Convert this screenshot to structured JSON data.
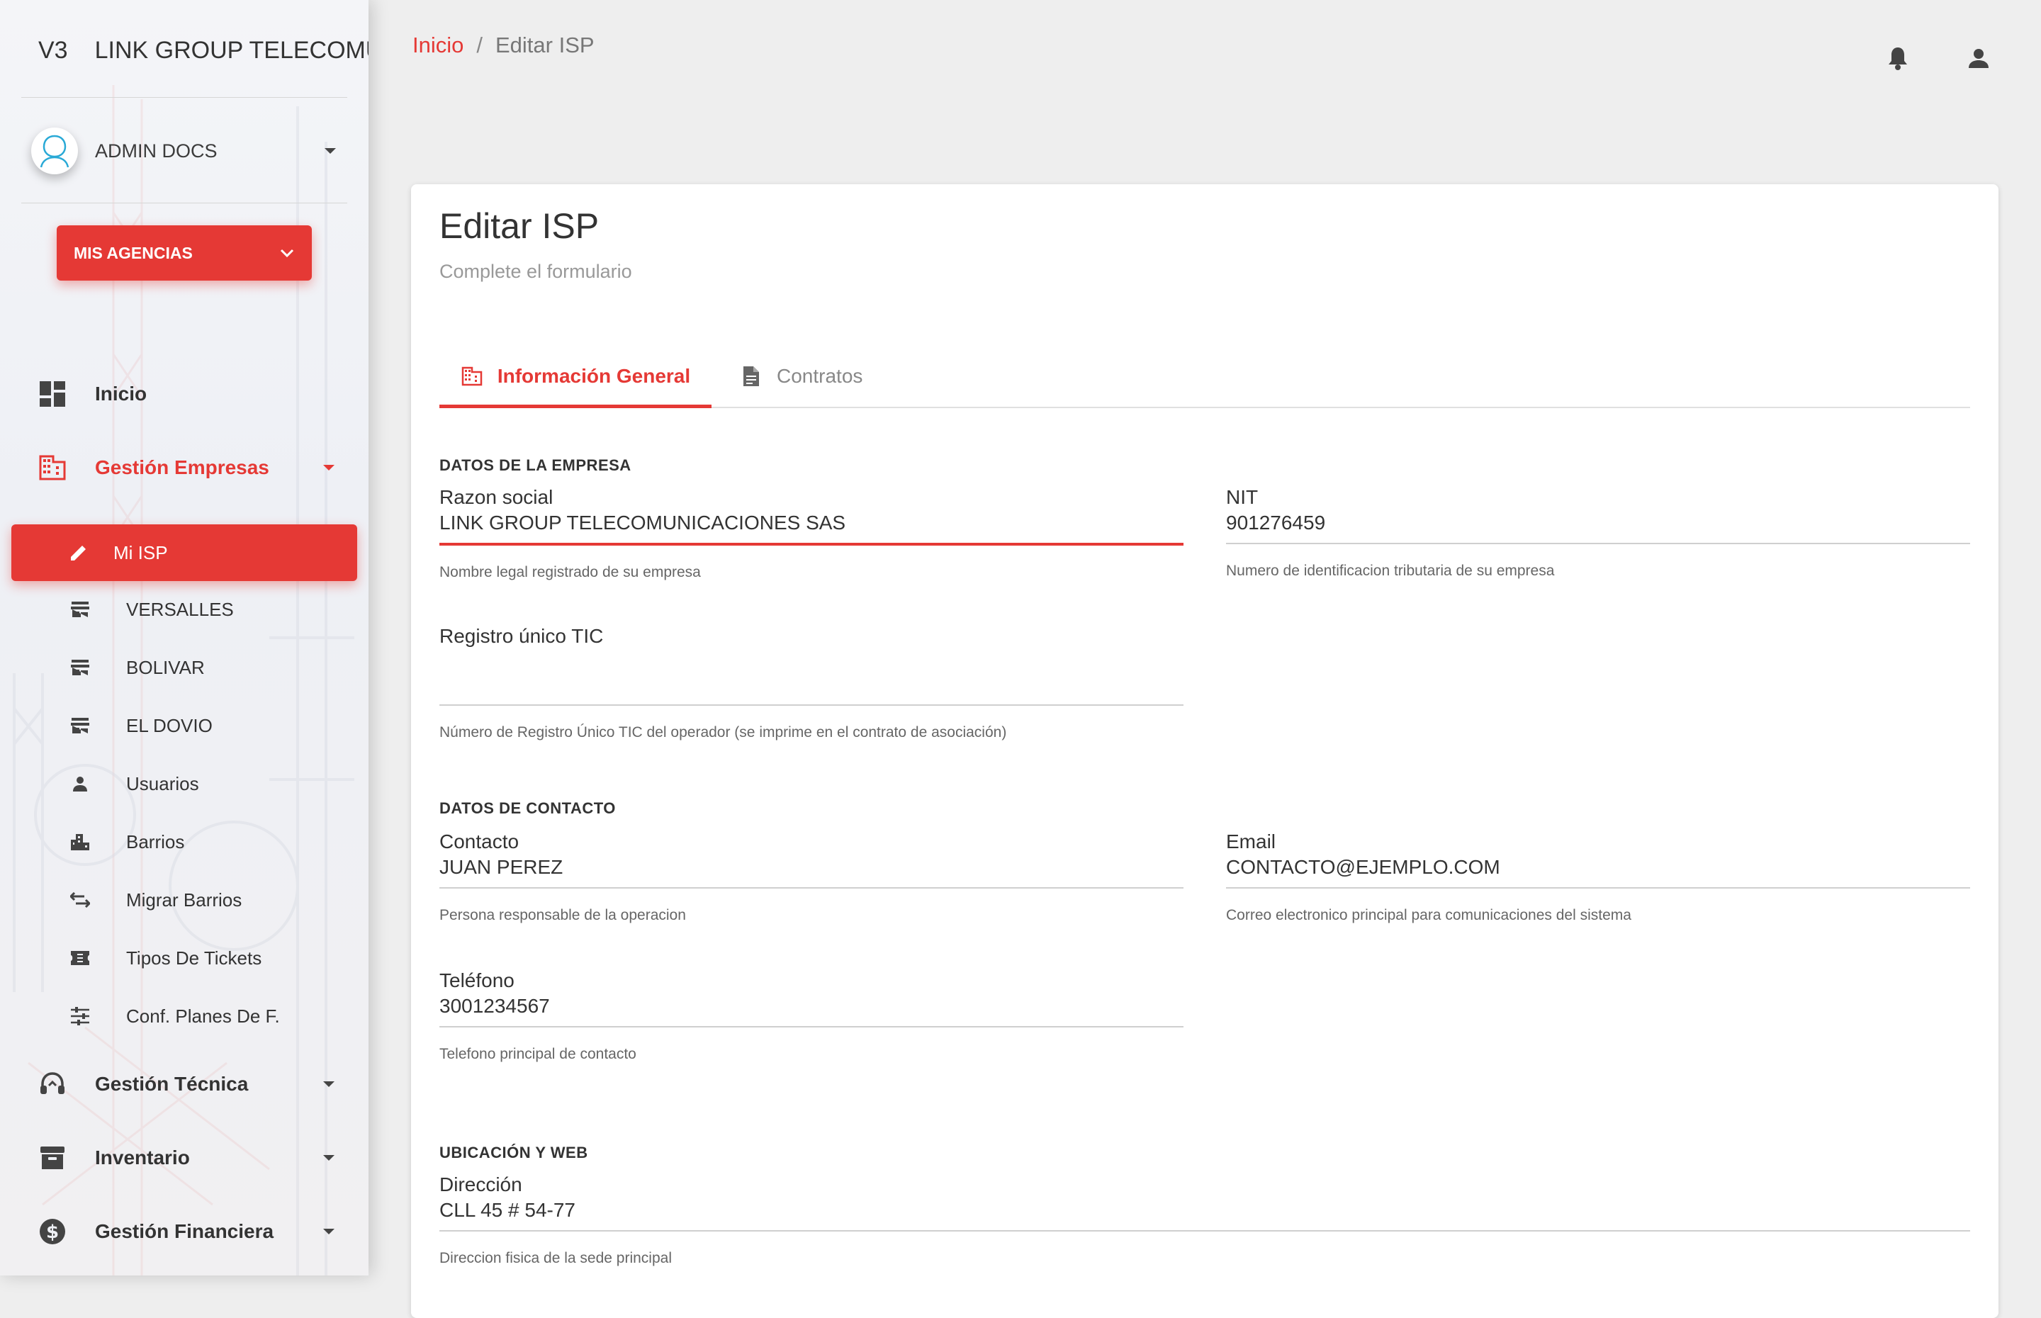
{
  "app": {
    "version": "V3",
    "name": "LINK GROUP TELECOMU"
  },
  "user": {
    "name": "ADMIN DOCS"
  },
  "agency_button": {
    "label": "MIS AGENCIAS"
  },
  "nav": {
    "inicio": "Inicio",
    "gestion_empresas": "Gestión Empresas",
    "gestion_tecnica": "Gestión Técnica",
    "inventario": "Inventario",
    "gestion_financiera": "Gestión Financiera"
  },
  "subnav": {
    "active": "Mi ISP",
    "items": [
      "VERSALLES",
      "BOLIVAR",
      "EL DOVIO",
      "Usuarios",
      "Barrios",
      "Migrar Barrios",
      "Tipos De Tickets",
      "Conf. Planes De F."
    ]
  },
  "breadcrumb": {
    "home": "Inicio",
    "separator": "/",
    "current": "Editar ISP"
  },
  "card": {
    "title": "Editar ISP",
    "subtitle": "Complete el formulario"
  },
  "tabs": [
    "Información General",
    "Contratos"
  ],
  "sections": {
    "empresa": "DATOS DE LA EMPRESA",
    "contacto": "DATOS DE CONTACTO",
    "ubicacion": "UBICACIÓN Y WEB"
  },
  "fields": {
    "razon_social": {
      "label": "Razon social",
      "value": "LINK GROUP TELECOMUNICACIONES SAS",
      "help": "Nombre legal registrado de su empresa"
    },
    "nit": {
      "label": "NIT",
      "value": "901276459",
      "help": "Numero de identificacion tributaria de su empresa"
    },
    "registro_tic": {
      "label": "Registro único TIC",
      "value": "",
      "help": "Número de Registro Único TIC del operador (se imprime en el contrato de asociación)"
    },
    "contacto": {
      "label": "Contacto",
      "value": "JUAN PEREZ",
      "help": "Persona responsable de la operacion"
    },
    "email": {
      "label": "Email",
      "value": "CONTACTO@EJEMPLO.COM",
      "help": "Correo electronico principal para comunicaciones del sistema"
    },
    "telefono": {
      "label": "Teléfono",
      "value": "3001234567",
      "help": "Telefono principal de contacto"
    },
    "direccion": {
      "label": "Dirección",
      "value": "CLL 45 # 54-77",
      "help": "Direccion fisica de la sede principal"
    }
  },
  "colors": {
    "accent": "#e53935",
    "text": "#333333",
    "muted": "#888888"
  }
}
